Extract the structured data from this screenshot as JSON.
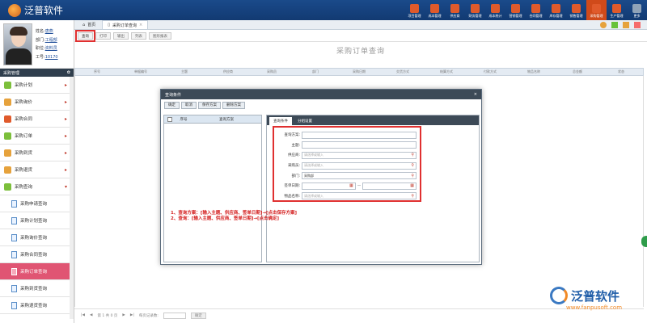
{
  "app": {
    "logo_text": "泛普软件"
  },
  "modules": [
    {
      "label": "项目管理",
      "color": "#e05a2b"
    },
    {
      "label": "成本管理",
      "color": "#e05a2b"
    },
    {
      "label": "供应商",
      "color": "#e05a2b"
    },
    {
      "label": "财务管理",
      "color": "#e05a2b"
    },
    {
      "label": "成本统计",
      "color": "#e05a2b"
    },
    {
      "label": "营销管理",
      "color": "#e05a2b"
    },
    {
      "label": "合同管理",
      "color": "#e05a2b"
    },
    {
      "label": "库存管理",
      "color": "#e05a2b"
    },
    {
      "label": "销售管理",
      "color": "#e05a2b"
    },
    {
      "label": "采购管理",
      "color": "#e05a2b"
    },
    {
      "label": "生产管理",
      "color": "#e05a2b"
    },
    {
      "label": "更多",
      "color": "#8fa3b8"
    }
  ],
  "profile": {
    "name_label": "姓名:",
    "name": "唐燕",
    "dept_label": "部门:",
    "dept": "工程部",
    "pos_label": "职位:",
    "pos": "资料员",
    "id_label": "工号:",
    "id": "10170"
  },
  "sidebar": {
    "header": "采购管理",
    "items": [
      {
        "label": "采购计划"
      },
      {
        "label": "采购询价"
      },
      {
        "label": "采购合同"
      },
      {
        "label": "采购订单"
      },
      {
        "label": "采购到货"
      },
      {
        "label": "采购退货"
      },
      {
        "label": "采购查询"
      }
    ],
    "subitems": [
      {
        "label": "采购申请查询"
      },
      {
        "label": "采购计划查询"
      },
      {
        "label": "采购询价查询"
      },
      {
        "label": "采购合同查询"
      },
      {
        "label": "采购订单查询"
      },
      {
        "label": "采购到货查询"
      },
      {
        "label": "采购退货查询"
      }
    ]
  },
  "tabs": {
    "home": "首页",
    "current": "采购订单查询"
  },
  "toolbar": {
    "query": "查询",
    "print": "打印",
    "export": "输出",
    "list": "列表",
    "chart": "图形报表"
  },
  "page": {
    "title": "采购订单查询"
  },
  "grid": {
    "columns": [
      "序号",
      "单据编号",
      "主题",
      "供应商",
      "采购员",
      "部门",
      "采购日期",
      "交货方式",
      "结算方式",
      "付款方式",
      "物品名称",
      "总金额",
      "状态"
    ]
  },
  "pager": {
    "page_info": "第 1 共 0 页",
    "page_size_label": "每页记录数:",
    "go": "确定"
  },
  "dialog": {
    "title": "查询条件",
    "buttons": {
      "ok": "确定",
      "cancel": "取消",
      "save": "保存方案",
      "delete": "删除方案"
    },
    "left_cols": {
      "no": "序号",
      "scheme": "查询方案"
    },
    "tabs": {
      "cond": "查询条件",
      "group": "分组设置"
    },
    "form": {
      "scheme_label": "查询方案:",
      "subject_label": "主题:",
      "supplier_label": "供应商:",
      "supplier_ph": "请选择或输入",
      "buyer_label": "采购员:",
      "buyer_ph": "请选择或输入",
      "dept_label": "部门:",
      "dept_value": "采购部",
      "date_label": "签单日期:",
      "item_label": "物品名称:",
      "item_ph": "请选择或输入"
    },
    "notes": {
      "line1": "1、查询方案：[输入主题、供应商、签单日期]→[点击保存方案]",
      "line2": "2、查询：[输入主题、供应商、签单日期]→[点击确定]"
    }
  },
  "brand": {
    "name": "泛普软件",
    "url": "www.fanpusoft.com"
  }
}
